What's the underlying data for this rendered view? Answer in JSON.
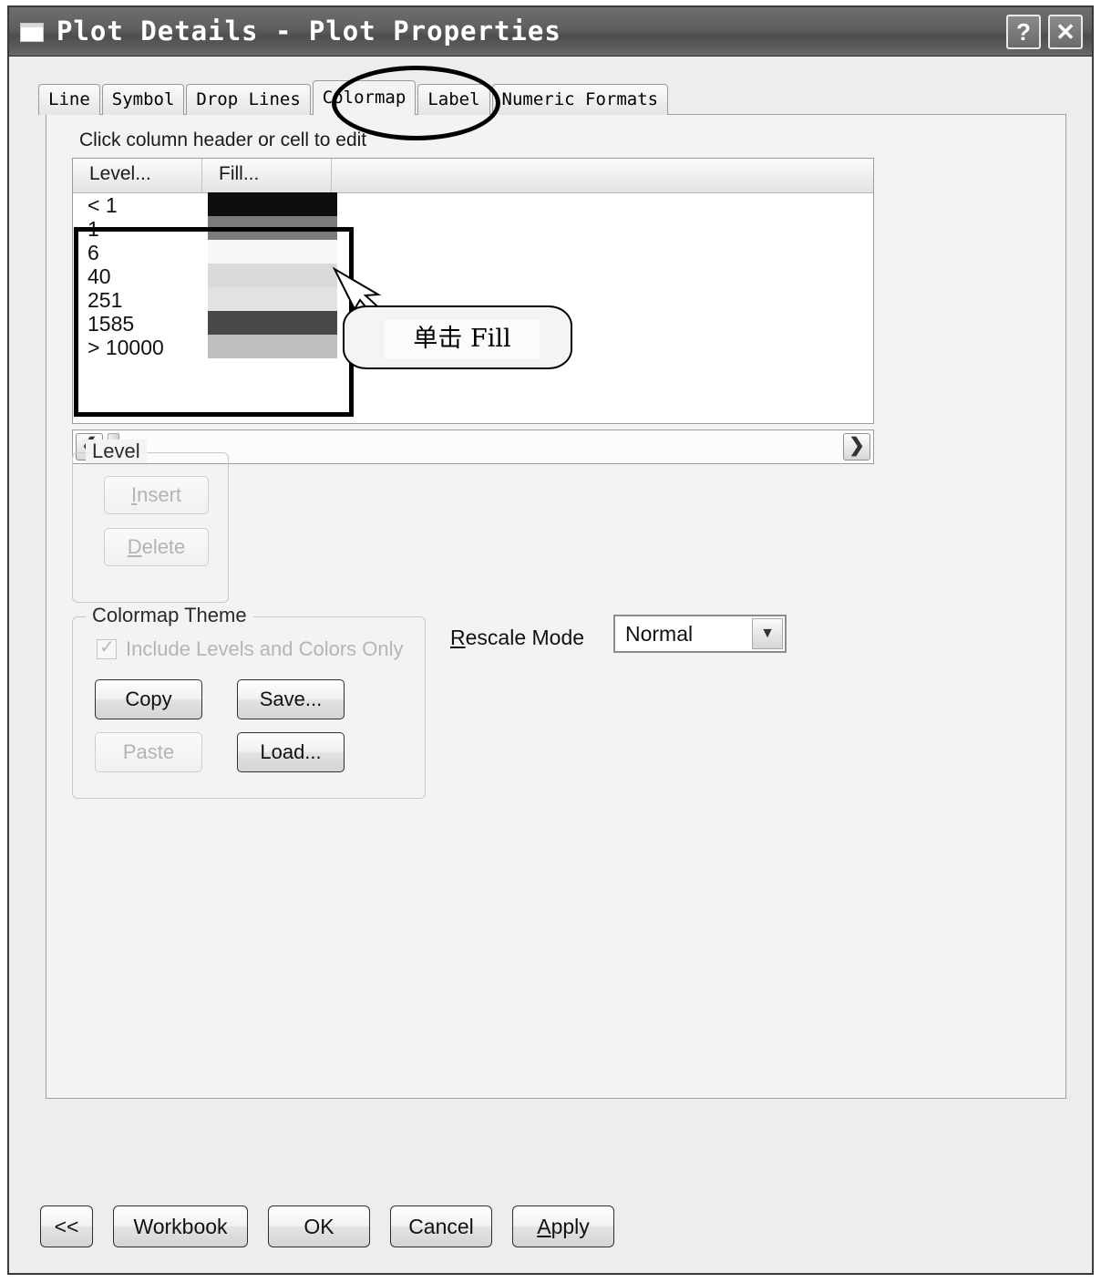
{
  "window": {
    "title": "Plot Details - Plot Properties",
    "icon": "window-icon",
    "help_label": "?",
    "close_label": "✕"
  },
  "tabs": [
    {
      "label": "Line",
      "active": false
    },
    {
      "label": "Symbol",
      "active": false
    },
    {
      "label": "Drop Lines",
      "active": false
    },
    {
      "label": "Colormap",
      "active": true
    },
    {
      "label": "Label",
      "active": false
    },
    {
      "label": "Numeric Formats",
      "active": false
    }
  ],
  "panel": {
    "hint": "Click column header or cell to edit"
  },
  "grid": {
    "headers": [
      "Level...",
      "Fill...",
      ""
    ],
    "rows": [
      {
        "level": "< 1",
        "fill": "#0d0d0d"
      },
      {
        "level": "1",
        "fill": "#7b7b7b"
      },
      {
        "level": "6",
        "fill": "#f7f7f7"
      },
      {
        "level": "40",
        "fill": "#dadada"
      },
      {
        "level": "251",
        "fill": "#e2e2e2"
      },
      {
        "level": "1585",
        "fill": "#484848"
      },
      {
        "level": "> 10000",
        "fill": "#bfbfbf"
      }
    ]
  },
  "scrollbar": {
    "left_arrow": "❮",
    "right_arrow": "❯"
  },
  "level_group": {
    "title": "Level",
    "insert": {
      "pre": "",
      "mnemonic": "I",
      "post": "nsert",
      "disabled": true
    },
    "delete": {
      "pre": "",
      "mnemonic": "D",
      "post": "elete",
      "disabled": true
    }
  },
  "theme_group": {
    "title": "Colormap Theme",
    "checkbox_label": "Include Levels and Colors Only",
    "checkbox_checked": true,
    "checkbox_disabled": true,
    "copy_label": "Copy",
    "save_label": "Save...",
    "paste_label": "Paste",
    "load_label": "Load..."
  },
  "rescale": {
    "label_mnemonic": "R",
    "label_rest": "escale Mode",
    "value": "Normal",
    "arrow": "▼"
  },
  "callout": {
    "text": "单击 Fill"
  },
  "bottom_buttons": {
    "prev": "<<",
    "workbook": "Workbook",
    "ok": "OK",
    "cancel": "Cancel",
    "apply_mnemonic": "A",
    "apply_rest": "pply"
  },
  "colors": {
    "titlebar_start": "#6e6e6e",
    "titlebar_end": "#4e4e4e",
    "panel_bg": "#f3f3f3",
    "dialog_bg": "#ededed",
    "annotation": "#000000"
  }
}
